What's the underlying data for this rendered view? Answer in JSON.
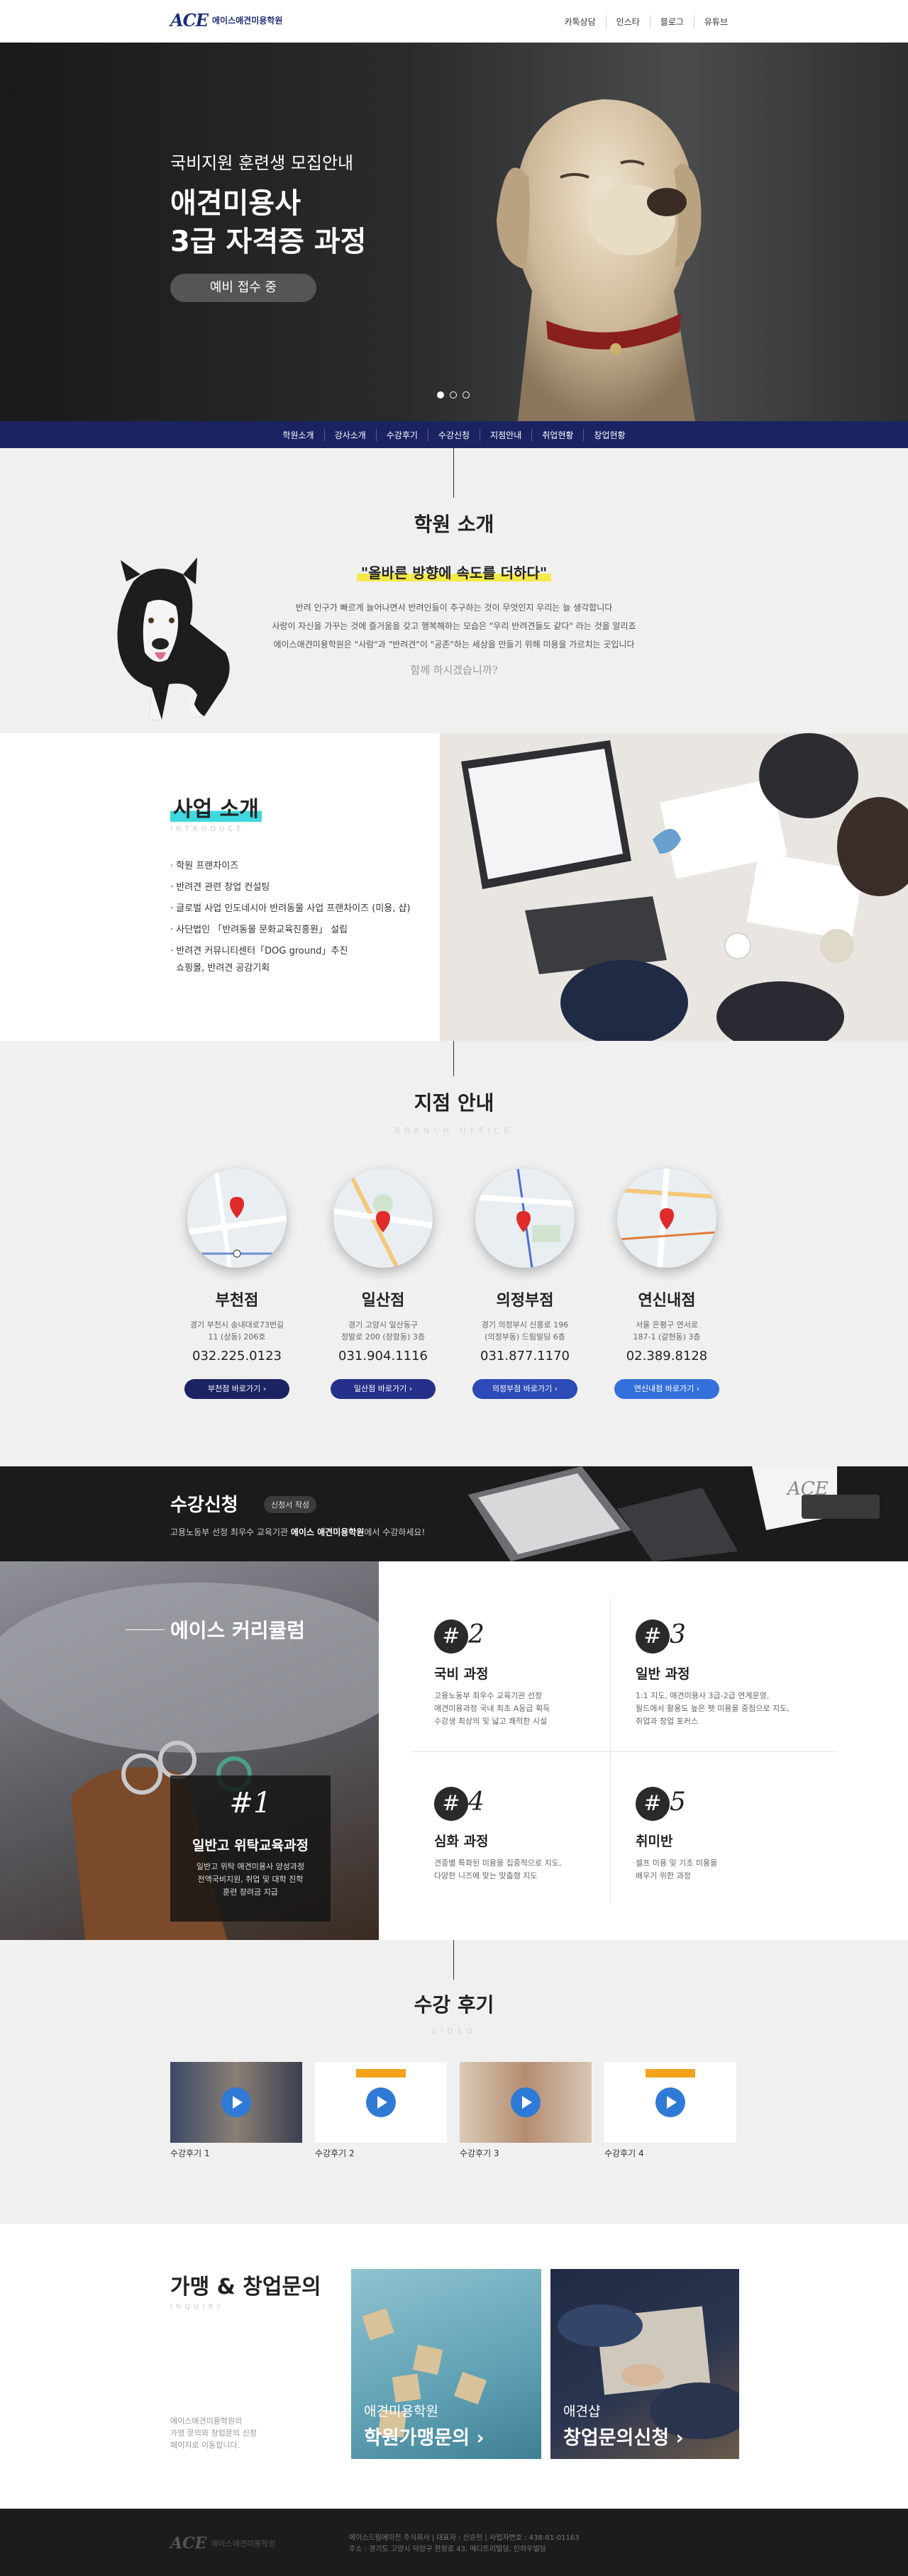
{
  "header": {
    "logo_mark": "ACE",
    "logo_name": "에이스애견미용학원",
    "nav": [
      "카톡상담",
      "인스타",
      "블로그",
      "유튜브"
    ]
  },
  "hero": {
    "subtitle": "국비지원 훈련생 모집안내",
    "title_line1": "애견미용사",
    "title_line2": "3급 자격증 과정",
    "pill": "예비 접수 중"
  },
  "subnav": [
    "학원소개",
    "강사소개",
    "수강후기",
    "수강신청",
    "지점안내",
    "취업현황",
    "창업현황"
  ],
  "about": {
    "title": "학원 소개",
    "slogan": "\"올바른 방향에 속도를 더하다\"",
    "desc1": "반려 인구가 빠르게 늘어나면서 반려인들이 추구하는 것이 무엇인지 우리는 늘 생각합니다",
    "desc2": "사랑이 자신을 가꾸는 것에 즐거움을 갖고 행복해하는 모습은 \"우리 반려견들도 같다\" 라는 것을 알리죠",
    "desc3": "에이스애견미용학원은 \"사람\"과 \"반려견\"이 \"공존\"하는 세상을 만들기 위해 미용을 가르치는 곳입니다",
    "question": "함께 하시겠습니까?"
  },
  "business": {
    "title": "사업 소개",
    "eng": "INTRODUCE",
    "items": [
      "학원 프랜차이즈",
      "반려견 관련 창업 컨설팅",
      "글로벌 사업 인도네시아 반려동물 사업 프랜차이즈 (미용, 샵)",
      "사단법인 「반려동물 문화교육진흥원」 설립",
      "반려견 커뮤니티센터「DOG ground」추진",
      "쇼핑몰, 반려견 공감기획"
    ]
  },
  "branches": {
    "title": "지점 안내",
    "eng": "BRANCH OFFICE",
    "list": [
      {
        "name": "부천점",
        "addr1": "경기 부천시 송내대로73번길",
        "addr2": "11 (상동) 206호",
        "phone": "032.225.0123",
        "btn": "부천점 바로가기",
        "color": "#1c2363"
      },
      {
        "name": "일산점",
        "addr1": "경기 고양시 일산동구",
        "addr2": "정발로 200 (장항동) 3층",
        "phone": "031.904.1116",
        "btn": "일산점 바로가기",
        "color": "#24308a"
      },
      {
        "name": "의정부점",
        "addr1": "경기 의정부시 신흥로 196",
        "addr2": "(의정부동) 드림빌딩 6층",
        "phone": "031.877.1170",
        "btn": "의정부점 바로가기",
        "color": "#2c4ab8"
      },
      {
        "name": "연신내점",
        "addr1": "서울 은평구 연서로",
        "addr2": "187-1 (갈현동) 3층",
        "phone": "02.389.8128",
        "btn": "연신내점 바로가기",
        "color": "#3470dc"
      }
    ]
  },
  "apply": {
    "title": "수강신청",
    "tag": "신청서 작성",
    "desc_pre": "고용노동부 선정 최우수 교육기관 ",
    "desc_bold": "에이스 애견미용학원",
    "desc_post": "에서 수강하세요!"
  },
  "curriculum": {
    "title": "에이스 커리큘럼",
    "main": {
      "num": "#1",
      "title": "일반고 위탁교육과정",
      "d1": "일반고 위탁 애견미용사 양성과정",
      "d2": "전액국비지원, 취업 및 대학 진학",
      "d3": "훈련 장려금 지급"
    },
    "items": [
      {
        "num": "2",
        "title": "국비 과정",
        "d1": "고용노동부 최우수 교육기관 선정",
        "d2": "애견미용과정 국내 최초 A등급 획득",
        "d3": "수강생 최상의 및 넓고 쾌적한 시설"
      },
      {
        "num": "3",
        "title": "일반 과정",
        "d1": "1:1 지도, 애견미용사 3급-2급 연계운영,",
        "d2": "필드에서 활용도 높은 펫 미용을 중점으로 지도,",
        "d3": "취업과 창업 포커스"
      },
      {
        "num": "4",
        "title": "심화 과정",
        "d1": "견종별 특화된 미용을 집중적으로 지도,",
        "d2": "다양한 니즈에 맞는 맞춤형 지도",
        "d3": ""
      },
      {
        "num": "5",
        "title": "취미반",
        "d1": "셀프 미용 및 기초 미용을",
        "d2": "배우기 위한 과정",
        "d3": ""
      }
    ]
  },
  "reviews": {
    "title": "수강 후기",
    "eng": "VIDEO",
    "items": [
      {
        "label": "수강후기 1",
        "thumb": "people"
      },
      {
        "label": "수강후기 2",
        "thumb": "text"
      },
      {
        "label": "수강후기 3",
        "thumb": "person"
      },
      {
        "label": "수강후기 4",
        "thumb": "text"
      }
    ]
  },
  "inquiry": {
    "title": "가맹 & 창업문의",
    "eng": "INQUIRY",
    "desc1": "에이스애견미용학원의",
    "desc2": "가맹 문의와 창업문의 신청",
    "desc3": "페이지로 이동합니다.",
    "box1_small": "애견미용학원",
    "box1_big": "학원가맹문의",
    "box2_small": "애견샵",
    "box2_big": "창업문의신청"
  },
  "footer": {
    "logo_mark": "ACE",
    "logo_name": "에이스애견미용학원",
    "line1": "에이스드림에이전 주식회사  |  대표자 : 신승현  |  사업자번호 : 438-81-01163",
    "line2": "주소 : 경기도 고양시 덕양구 한창로 43, 메디트리빌딩, 인하우빌딩"
  }
}
